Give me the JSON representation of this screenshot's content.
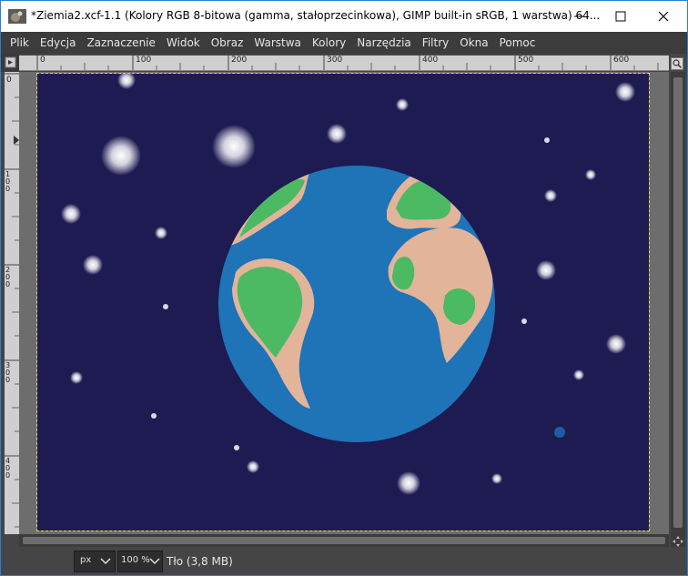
{
  "window": {
    "title": "*Ziemia2.xcf-1.1 (Kolory RGB 8-bitowa (gamma, stałoprzecinkowa), GIMP built-in sRGB, 1 warstwa) 64...",
    "app_icon": "gimp-icon",
    "controls": [
      "minimize-icon",
      "maximize-icon",
      "close-icon"
    ]
  },
  "menubar": {
    "items": [
      "Plik",
      "Edycja",
      "Zaznaczenie",
      "Widok",
      "Obraz",
      "Warstwa",
      "Kolory",
      "Narzędzia",
      "Filtry",
      "Okna",
      "Pomoc"
    ]
  },
  "ruler": {
    "h_labels": [
      "0",
      "100",
      "200",
      "300",
      "400",
      "500",
      "600"
    ],
    "v_labels": [
      "0",
      "100",
      "200",
      "300",
      "400"
    ]
  },
  "statusbar": {
    "unit": "px",
    "zoom": "100 %",
    "layer_info": "Tło (3,8 MB)"
  },
  "colors": {
    "space": "#1e1a52",
    "ocean": "#1f73b7",
    "land": "#e2b49a",
    "vegetation": "#4cb963",
    "selection": "#e8d34a"
  }
}
